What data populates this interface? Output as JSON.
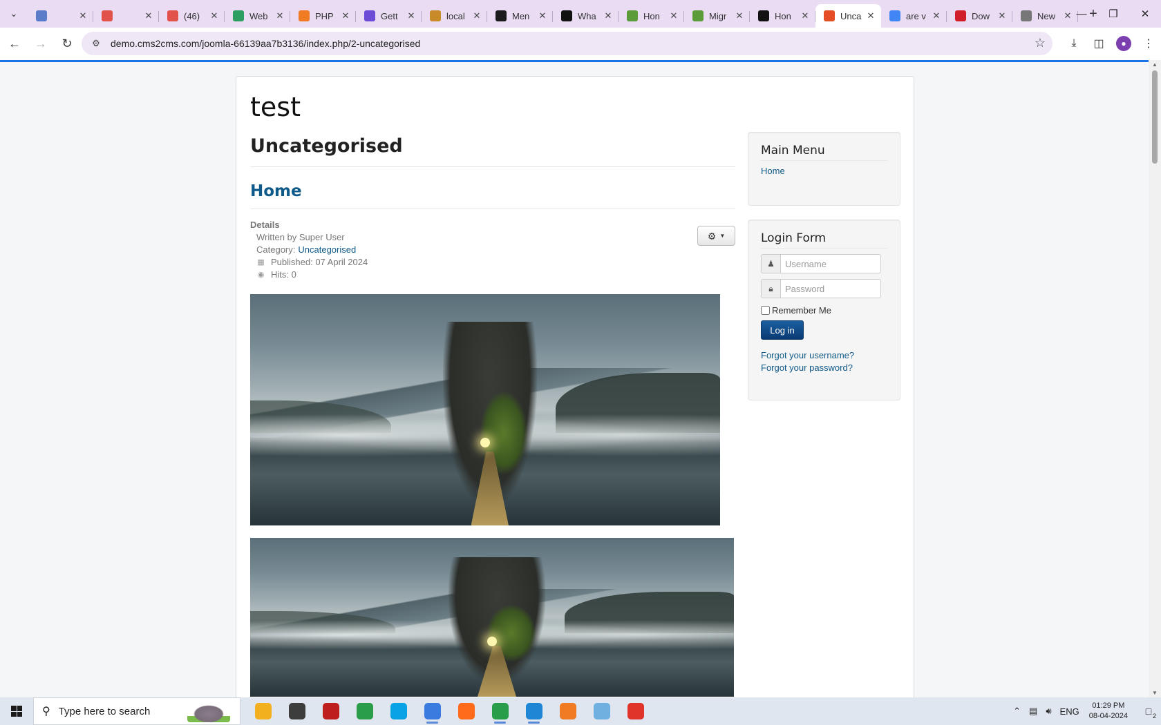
{
  "browser": {
    "tabs": [
      {
        "label": "",
        "icon": "page-icon",
        "color": "#5b7dc9"
      },
      {
        "label": "",
        "icon": "check-icon",
        "color": "#e0524a"
      },
      {
        "label": "(46)",
        "icon": "check-icon",
        "color": "#e0524a"
      },
      {
        "label": "Web",
        "icon": "webflow-icon",
        "color": "#2d9e5f"
      },
      {
        "label": "PHP",
        "icon": "diamond-icon",
        "color": "#f07b22"
      },
      {
        "label": "Gett",
        "icon": "stripe-icon",
        "color": "#6c4bd6"
      },
      {
        "label": "local",
        "icon": "chart-icon",
        "color": "#c98b2a"
      },
      {
        "label": "Men",
        "icon": "joomla-icon",
        "color": "#1b1b1b"
      },
      {
        "label": "Wha",
        "icon": "wix-icon",
        "color": "#111111"
      },
      {
        "label": "Hon",
        "icon": "ring-icon",
        "color": "#5c9b3a"
      },
      {
        "label": "Migr",
        "icon": "ring-icon",
        "color": "#5c9b3a"
      },
      {
        "label": "Hon",
        "icon": "wix-icon",
        "color": "#111111"
      },
      {
        "label": "Unca",
        "icon": "joomla-icon",
        "color": "#e44d26",
        "active": true
      },
      {
        "label": "are v",
        "icon": "google-icon",
        "color": "#4285f4"
      },
      {
        "label": "Dow",
        "icon": "opera-icon",
        "color": "#d11f2a"
      },
      {
        "label": "New",
        "icon": "chrome-icon",
        "color": "#777777"
      }
    ],
    "url": "demo.cms2cms.com/joomla-66139aa7b3136/index.php/2-uncategorised"
  },
  "site": {
    "brand": "test",
    "page_heading": "Uncategorised",
    "article_title": "Home",
    "details": {
      "label": "Details",
      "written_by": "Written by Super User",
      "category_prefix": "Category:",
      "category": "Uncategorised",
      "published": "Published: 07 April 2024",
      "hits": "Hits: 0"
    }
  },
  "sidebar": {
    "main_menu": {
      "title": "Main Menu",
      "items": [
        "Home"
      ]
    },
    "login": {
      "title": "Login Form",
      "username_placeholder": "Username",
      "password_placeholder": "Password",
      "remember_label": "Remember Me",
      "login_button": "Log in",
      "forgot_username": "Forgot your username?",
      "forgot_password": "Forgot your password?"
    }
  },
  "taskbar": {
    "search_placeholder": "Type here to search",
    "apps": [
      {
        "name": "file-explorer-icon",
        "color": "#f2b01e",
        "open": false
      },
      {
        "name": "sublime-icon",
        "color": "#3d3d3d",
        "open": false
      },
      {
        "name": "filezilla-icon",
        "color": "#bf1e1e",
        "open": false
      },
      {
        "name": "chrome-icon",
        "color": "#2a9d4a",
        "open": false
      },
      {
        "name": "skype-icon",
        "color": "#0aa2e6",
        "open": false
      },
      {
        "name": "chat-icon",
        "color": "#3b7be0",
        "open": true
      },
      {
        "name": "firefox-icon",
        "color": "#ff6b1a",
        "open": false
      },
      {
        "name": "chrome-profile-icon",
        "color": "#2a9d4a",
        "open": true
      },
      {
        "name": "vscode-icon",
        "color": "#1f86d6",
        "open": true
      },
      {
        "name": "xampp-icon",
        "color": "#f07b22",
        "open": false
      },
      {
        "name": "notepad-icon",
        "color": "#6fb0e0",
        "open": false
      },
      {
        "name": "wps-icon",
        "color": "#e0332a",
        "open": false
      }
    ],
    "language": "ENG",
    "time": "01:29 PM",
    "date": "08-04-2024",
    "notifications": "2"
  }
}
